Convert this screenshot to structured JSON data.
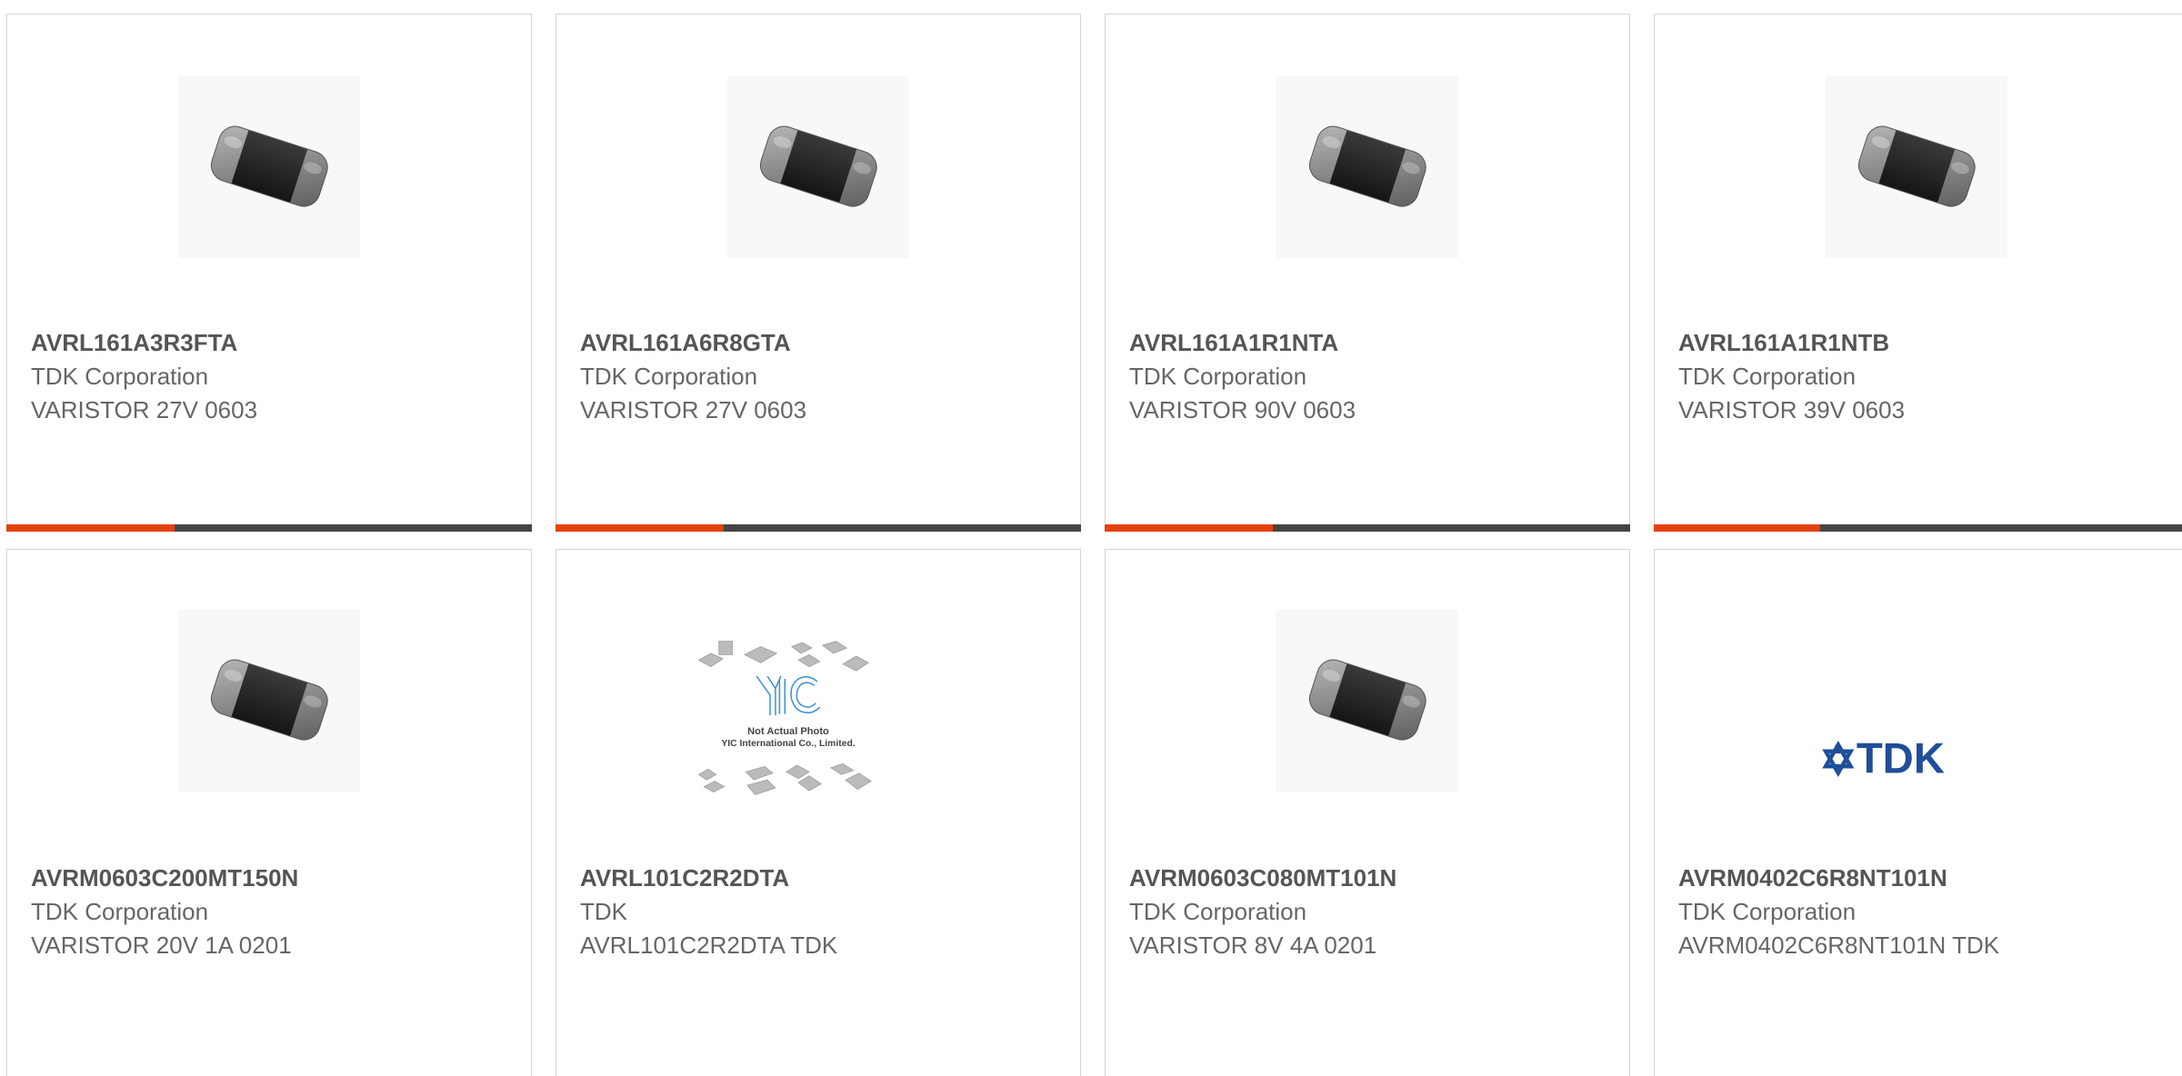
{
  "colors": {
    "accent": "#e6410f",
    "bar_track": "#444444",
    "card_border": "#d6d6d6",
    "tdk_blue": "#1f4e9a"
  },
  "cards": [
    {
      "part": "AVRL161A3R3FTA",
      "manufacturer": "TDK Corporation",
      "description": "VARISTOR 27V 0603",
      "image": "chip-varistor-photo",
      "progress": 0.32
    },
    {
      "part": "AVRL161A6R8GTA",
      "manufacturer": "TDK Corporation",
      "description": "VARISTOR 27V 0603",
      "image": "chip-varistor-photo",
      "progress": 0.32
    },
    {
      "part": "AVRL161A1R1NTA",
      "manufacturer": "TDK Corporation",
      "description": "VARISTOR 90V 0603",
      "image": "chip-varistor-photo",
      "progress": 0.32
    },
    {
      "part": "AVRL161A1R1NTB",
      "manufacturer": "TDK Corporation",
      "description": "VARISTOR 39V 0603",
      "image": "chip-varistor-photo",
      "progress": 0.31
    },
    {
      "part": "AVRM0603C200MT150N",
      "manufacturer": "TDK Corporation",
      "description": "VARISTOR 20V 1A 0201",
      "image": "chip-varistor-photo"
    },
    {
      "part": "AVRL101C2R2DTA",
      "manufacturer": "TDK",
      "description": "AVRL101C2R2DTA TDK",
      "image": "yic-placeholder",
      "image_text": {
        "logo": "YIC",
        "line1": "Not Actual Photo",
        "line2": "YIC International Co., Limited."
      }
    },
    {
      "part": "AVRM0603C080MT101N",
      "manufacturer": "TDK Corporation",
      "description": "VARISTOR 8V 4A 0201",
      "image": "chip-varistor-photo"
    },
    {
      "part": "AVRM0402C6R8NT101N",
      "manufacturer": "TDK Corporation",
      "description": "AVRM0402C6R8NT101N TDK",
      "image": "tdk-logo",
      "image_text": {
        "logo": "TDK"
      }
    }
  ]
}
